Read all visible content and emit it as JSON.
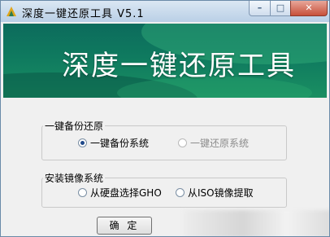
{
  "window": {
    "title": "深度一键还原工具 V5.1"
  },
  "banner": {
    "title": "深度一键还原工具"
  },
  "backup_group": {
    "legend": "一键备份还原",
    "options": [
      {
        "label": "一键备份系统",
        "selected": true,
        "enabled": true
      },
      {
        "label": "一键还原系统",
        "selected": false,
        "enabled": false
      }
    ]
  },
  "install_group": {
    "legend": "安装镜像系统",
    "options": [
      {
        "label": "从硬盘选择GHO",
        "selected": false,
        "enabled": true
      },
      {
        "label": "从ISO镜像提取",
        "selected": false,
        "enabled": true
      }
    ]
  },
  "confirm_label": "确 定",
  "colors": {
    "banner": "#0f7a5f",
    "titlebar": "#b9cfe6",
    "close": "#c7503a"
  },
  "icons": {
    "app": "app-logo-icon",
    "minimize": "minimize-icon",
    "maximize": "maximize-icon",
    "close": "close-icon",
    "radio": "radio-button-icon"
  }
}
